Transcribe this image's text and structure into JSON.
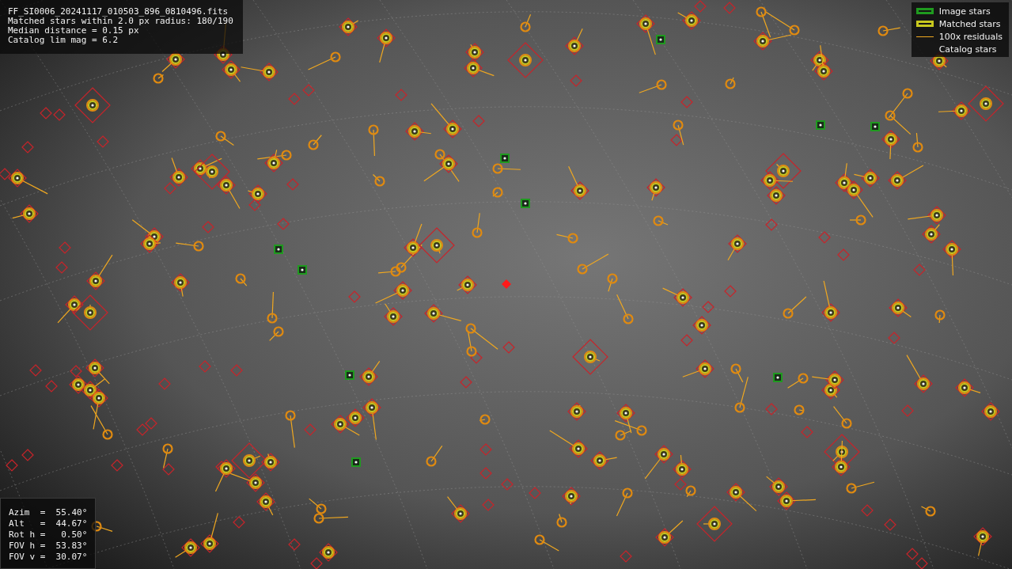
{
  "info": {
    "lines": [
      "FF_SI0006_20241117_010503_896_0810496.fits",
      "Matched stars within 2.0 px radius: 180/190",
      "Median distance = 0.15 px",
      "Catalog lim mag = 6.2"
    ]
  },
  "legend": [
    {
      "label": "Image stars",
      "kind": "box",
      "color": "#1f9a1f"
    },
    {
      "label": "Matched stars",
      "kind": "box",
      "color": "#c8c81e"
    },
    {
      "label": "100x residuals",
      "kind": "line",
      "color": "#f0a820"
    },
    {
      "label": "Catalog stars",
      "kind": "none"
    }
  ],
  "pointing": {
    "lines": [
      "Azim  =  55.40°",
      "Alt   =  44.67°",
      "Rot h =   0.50°",
      "FOV h =  53.83°",
      "FOV v =  30.07°"
    ]
  }
}
